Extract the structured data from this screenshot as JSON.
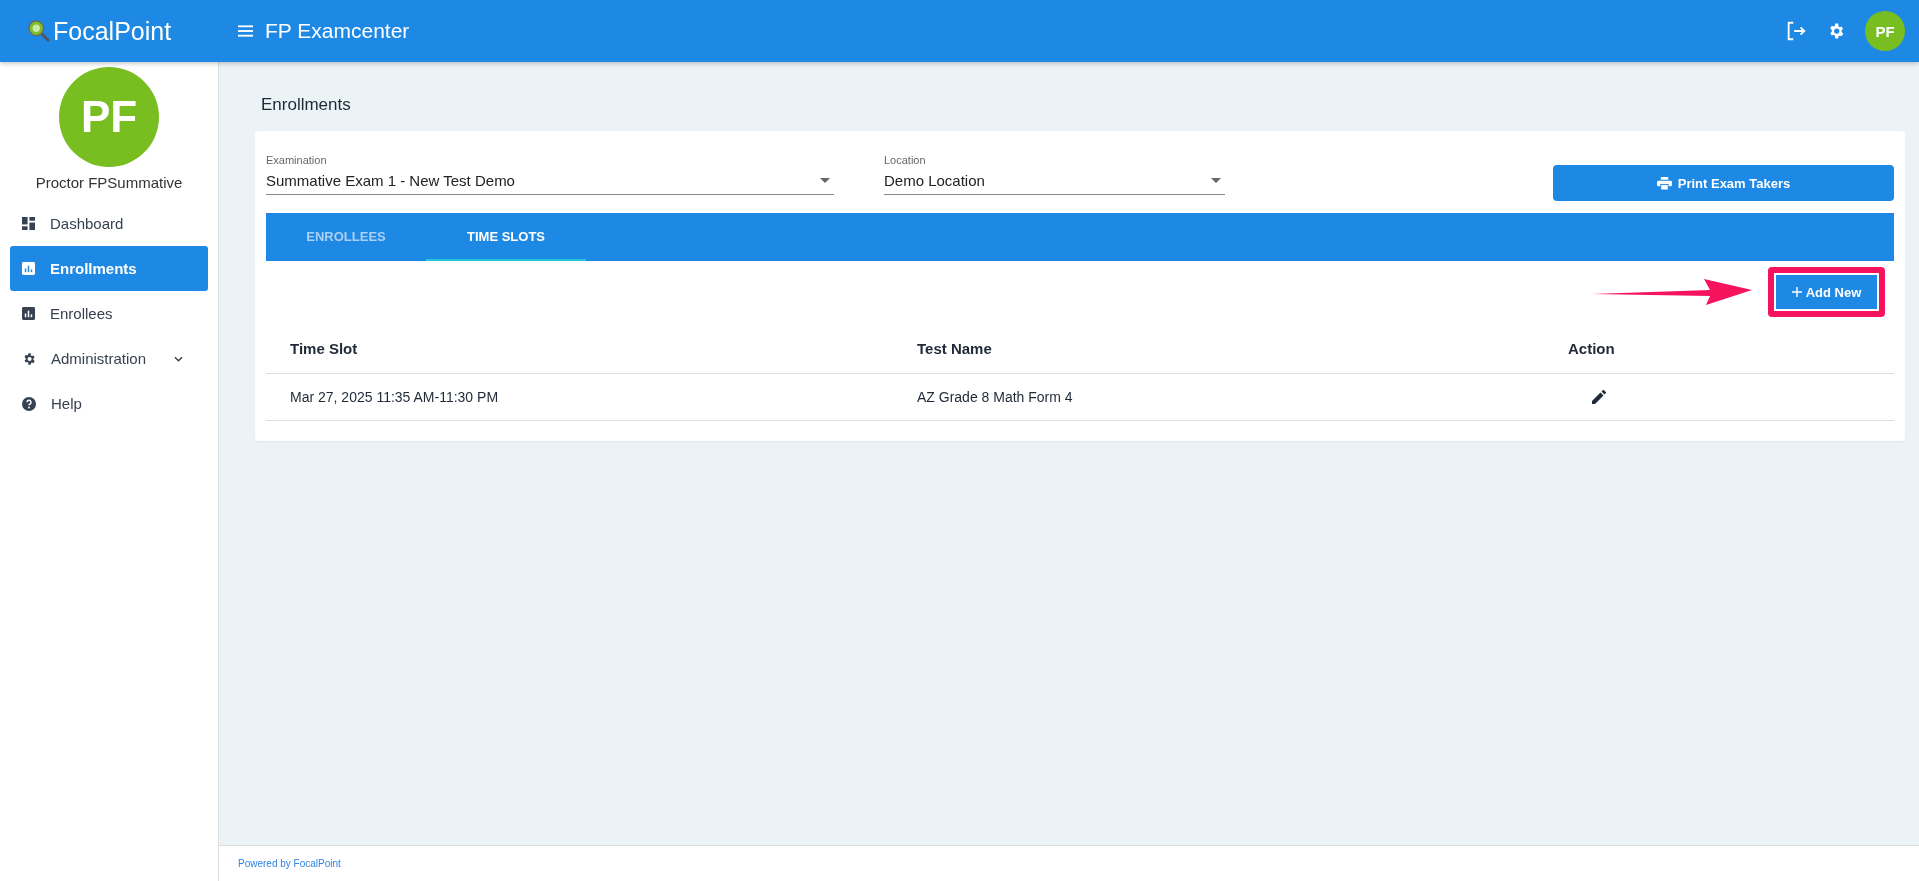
{
  "header": {
    "logo": "FocalPoint",
    "title": "FP Examcenter",
    "avatar": "PF"
  },
  "sidebar": {
    "avatar": "PF",
    "user_name": "Proctor FPSummative",
    "items": [
      {
        "label": "Dashboard",
        "selected": false,
        "expandable": false
      },
      {
        "label": "Enrollments",
        "selected": true,
        "expandable": false
      },
      {
        "label": "Enrollees",
        "selected": false,
        "expandable": false
      },
      {
        "label": "Administration",
        "selected": false,
        "expandable": true
      },
      {
        "label": "Help",
        "selected": false,
        "expandable": false
      }
    ]
  },
  "page_title": "Enrollments",
  "filters": [
    {
      "label": "Examination",
      "value": "Summative Exam 1 - New Test Demo"
    },
    {
      "label": "Location",
      "value": "Demo Location"
    }
  ],
  "print_button": "Print Exam Takers",
  "tabs": [
    {
      "label": "ENROLLEES",
      "selected": false
    },
    {
      "label": "TIME SLOTS",
      "selected": true
    }
  ],
  "add_button": "Add New",
  "table": {
    "columns": [
      "Time Slot",
      "Test Name",
      "Action"
    ],
    "rows": [
      {
        "cells": [
          "Mar 27, 2025 11:35 AM-11:30 PM",
          "AZ Grade 8 Math Form 4"
        ]
      }
    ]
  },
  "footer": {
    "prefix": "Powered by",
    "link": "FocalPoint"
  }
}
